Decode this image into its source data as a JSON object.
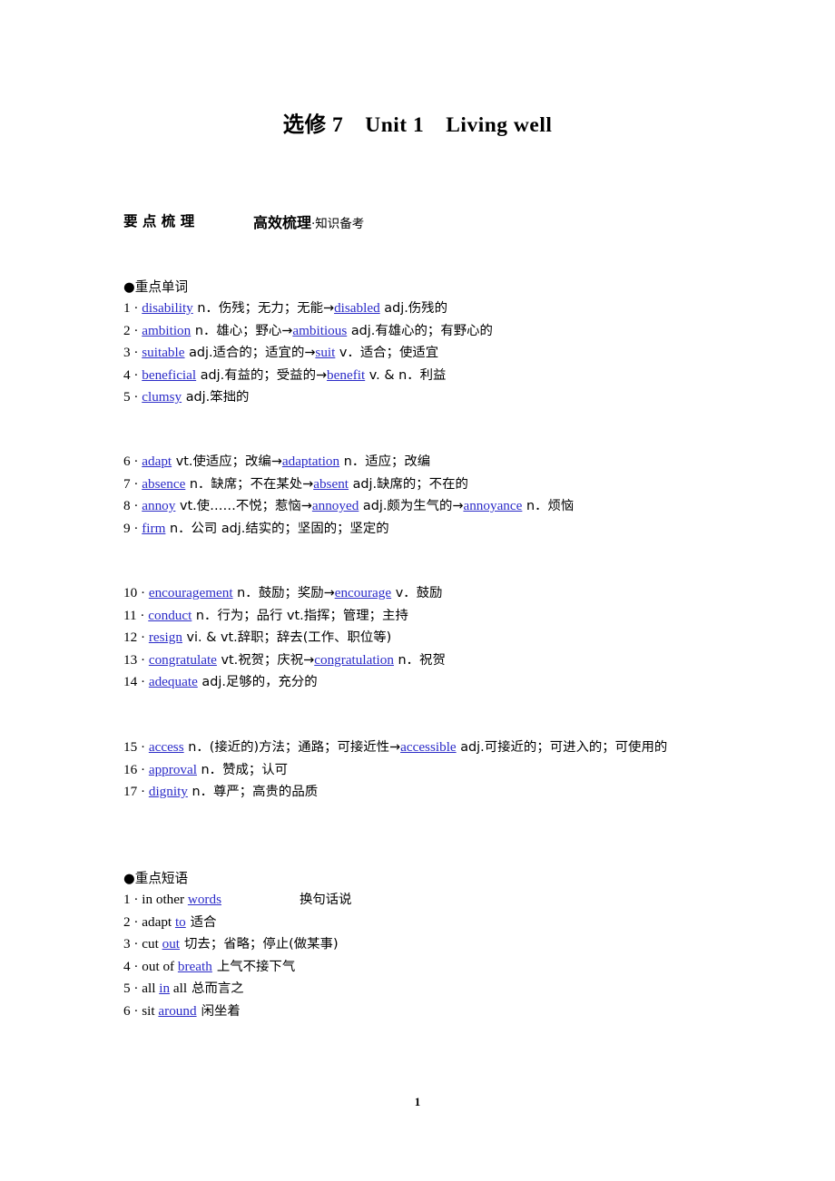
{
  "document": {
    "title": "选修 7　Unit 1　Living well",
    "page_number": "1"
  },
  "section_header": {
    "label": "要 点 梳 理",
    "subtitle_main": "高效梳理",
    "subtitle_tail": "·知识备考"
  },
  "words_section": {
    "heading": "●重点单词",
    "entries": [
      {
        "num": "1 ·",
        "word": "disability",
        "body_1": " n．伤残；无力；无能→",
        "word_2": "disabled",
        "body_2": " adj.伤残的"
      },
      {
        "num": "2 ·",
        "word": "ambition",
        "body_1": " n．雄心；野心→",
        "word_2": "ambitious",
        "body_2": " adj.有雄心的；有野心的"
      },
      {
        "num": "3 ·",
        "word": "suitable",
        "body_1": " adj.适合的；适宜的→",
        "word_2": "suit",
        "body_2": " v．适合；使适宜"
      },
      {
        "num": "4 ·",
        "word": "beneficial",
        "body_1": " adj.有益的；受益的→",
        "word_2": "benefit",
        "body_2": " v. & n．利益"
      },
      {
        "num": "5 ·",
        "word": "clumsy",
        "body_1": " adj.笨拙的",
        "word_2": "",
        "body_2": ""
      },
      {
        "num": "6 ·",
        "word": "adapt",
        "body_1": " vt.使适应；改编→",
        "word_2": "adaptation",
        "body_2": " n．适应；改编"
      },
      {
        "num": "7 ·",
        "word": "absence",
        "body_1": " n．缺席；不在某处→",
        "word_2": "absent",
        "body_2": " adj.缺席的；不在的"
      },
      {
        "num": "8 ·",
        "word": "annoy",
        "body_1": " vt.使……不悦；惹恼→",
        "word_2": "annoyed",
        "body_2": " adj.颇为生气的→",
        "word_3": "annoyance",
        "body_3": " n．烦恼"
      },
      {
        "num": "9 ·",
        "word": "firm",
        "body_1": " n．公司  adj.结实的；坚固的；坚定的",
        "word_2": "",
        "body_2": ""
      },
      {
        "num": "10 ·",
        "word": "encouragement",
        "body_1": " n．鼓励；奖励→",
        "word_2": "encourage",
        "body_2": " v．鼓励"
      },
      {
        "num": "11 ·",
        "word": "conduct",
        "body_1": " n．行为；品行  vt.指挥；管理；主持",
        "word_2": "",
        "body_2": ""
      },
      {
        "num": "12 ·",
        "word": "resign",
        "body_1": " vi. & vt.辞职；辞去(工作、职位等)",
        "word_2": "",
        "body_2": ""
      },
      {
        "num": "13 ·",
        "word": "congratulate",
        "body_1": " vt.祝贺；庆祝→",
        "word_2": "congratulation",
        "body_2": " n．祝贺"
      },
      {
        "num": "14 ·",
        "word": "adequate",
        "body_1": " adj.足够的，充分的",
        "word_2": "",
        "body_2": ""
      },
      {
        "num": "15 ·",
        "word": "access",
        "body_1": " n．(接近的)方法；通路；可接近性→",
        "word_2": "accessible",
        "body_2": " adj.可接近的；可进入的；可使用的"
      },
      {
        "num": "16 ·",
        "word": "approval",
        "body_1": " n．赞成；认可",
        "word_2": "",
        "body_2": ""
      },
      {
        "num": "17 ·",
        "word": "dignity",
        "body_1": " n．尊严；高贵的品质",
        "word_2": "",
        "body_2": ""
      }
    ]
  },
  "phrases_section": {
    "heading": "●重点短语",
    "entries": [
      {
        "num": "1 ·",
        "pre": "in other ",
        "word": "words",
        "post": "",
        "meaning": "换句话说",
        "spacer": true
      },
      {
        "num": "2 ·",
        "pre": "adapt ",
        "word": "to",
        "post": "",
        "meaning": "适合",
        "spacer": false
      },
      {
        "num": "3 ·",
        "pre": "cut ",
        "word": "out",
        "post": "",
        "meaning": "切去；省略；停止(做某事)",
        "spacer": false
      },
      {
        "num": "4 ·",
        "pre": "out of ",
        "word": "breath",
        "post": "",
        "meaning": "上气不接下气",
        "spacer": false
      },
      {
        "num": "5 ·",
        "pre": "all ",
        "word": "in",
        "post": " all",
        "meaning": "总而言之",
        "spacer": false
      },
      {
        "num": "6 ·",
        "pre": "sit ",
        "word": "around",
        "post": "",
        "meaning": "闲坐着",
        "spacer": false
      }
    ]
  },
  "colors": {
    "link_blue": "#2b2bc8",
    "text_black": "#000000",
    "page_background": "#ffffff"
  }
}
